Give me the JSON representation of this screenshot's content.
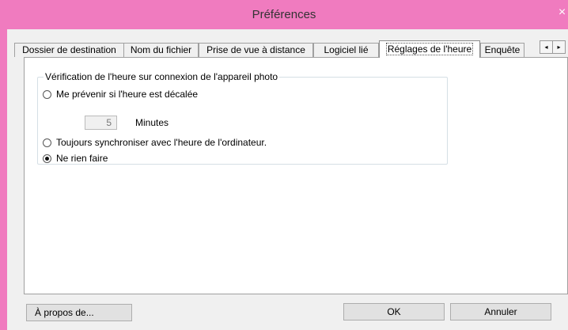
{
  "window": {
    "title": "Préférences"
  },
  "tabs": [
    {
      "label": "Dossier de destination"
    },
    {
      "label": "Nom du fichier"
    },
    {
      "label": "Prise de vue à distance"
    },
    {
      "label": "Logiciel lié"
    },
    {
      "label": "Réglages de l'heure",
      "active": true
    },
    {
      "label": "Enquête"
    }
  ],
  "tab_scroll": {
    "left": "◂",
    "right": "▸"
  },
  "group": {
    "legend": "Vérification de l'heure sur connexion de l'appareil photo",
    "options": [
      {
        "label": "Me prévenir si l'heure est décalée",
        "checked": false
      },
      {
        "label": "Toujours synchroniser avec l'heure de l'ordinateur.",
        "checked": false
      },
      {
        "label": "Ne rien faire",
        "checked": true
      }
    ],
    "minutes_value": "5",
    "minutes_unit": "Minutes"
  },
  "buttons": {
    "about": "À propos de...",
    "ok": "OK",
    "cancel": "Annuler"
  },
  "icons": {
    "close": "close-icon"
  }
}
